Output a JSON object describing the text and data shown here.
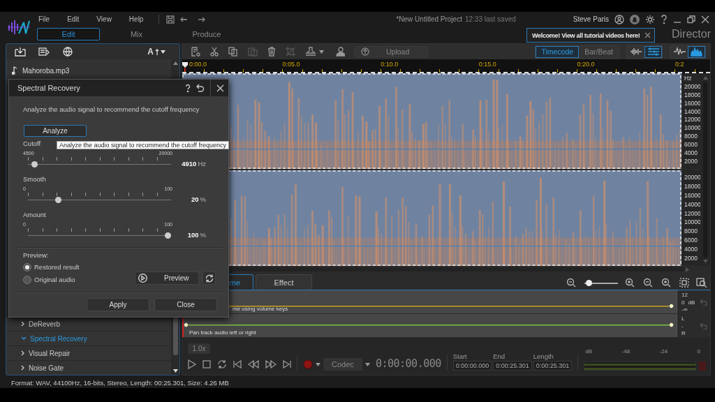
{
  "menu": [
    "File",
    "Edit",
    "View",
    "Help"
  ],
  "project": {
    "title": "*New Untitled Project",
    "saved": "12:33 last saved"
  },
  "user": {
    "name": "Steve Paris"
  },
  "mode_tabs": [
    {
      "label": "Edit",
      "selected": true
    },
    {
      "label": "Mix",
      "selected": false
    },
    {
      "label": "Produce",
      "selected": false
    }
  ],
  "brand": "Director",
  "welcome_tip": "Welcome! View all tutorial videos here!",
  "library": {
    "font_button": "A",
    "file": "Mahoroba.mp3",
    "effects": [
      {
        "label": "DeReverb",
        "expanded": false
      },
      {
        "label": "Spectral Recovery",
        "expanded": true
      },
      {
        "label": "Visual Repair",
        "expanded": false
      },
      {
        "label": "Noise Gate",
        "expanded": false
      }
    ]
  },
  "toolbar": {
    "upload": "Upload",
    "time_modes": [
      {
        "label": "Timecode",
        "selected": true
      },
      {
        "label": "Bar/Beat",
        "selected": false
      }
    ],
    "view_toggles": [
      {
        "kind": "waveform",
        "selected": false
      },
      {
        "kind": "tracks",
        "selected": true
      },
      {
        "kind": "pulse",
        "selected": false
      },
      {
        "kind": "spectrum",
        "selected": true
      }
    ]
  },
  "ruler": [
    "0:00.0",
    "0:05.0",
    "0:10.0",
    "0:15.0",
    "0:20.0",
    "0:2"
  ],
  "freq_axis": {
    "unit": "Hz",
    "channels": [
      [
        "20000",
        "18000",
        "16000",
        "14000",
        "12000",
        "10000",
        "8000",
        "6000",
        "4000",
        "2000"
      ],
      [
        "20000",
        "18000",
        "16000",
        "14000",
        "12000",
        "10000",
        "8000",
        "6000",
        "4000",
        "2000"
      ]
    ]
  },
  "lane_tabs": [
    {
      "label": "me",
      "selected": true
    },
    {
      "label": "Effect",
      "selected": false
    }
  ],
  "zoom": {
    "level": 0.05
  },
  "envelopes": [
    {
      "kind": "volume",
      "hint": "me using volume keys",
      "scale": [
        "12",
        "0",
        "-∞"
      ],
      "unit": "dB"
    },
    {
      "kind": "pan",
      "hint": "Pan track audio left or right",
      "scale": [
        "L",
        "-",
        "R"
      ]
    }
  ],
  "transport": {
    "speed": "1.0x",
    "codec": "Codec",
    "time": "0:00:00.000",
    "fields": [
      {
        "label": "Start",
        "value": "0:00:00.000"
      },
      {
        "label": "End",
        "value": "0:00:25.301"
      },
      {
        "label": "Length",
        "value": "0:00:25.301"
      }
    ],
    "meter_scale": [
      "dB",
      "-48",
      "-24",
      "0"
    ]
  },
  "dialog": {
    "title": "Spectral Recovery",
    "description": "Analyze the audio signal to recommend the cutoff frequency",
    "analyze": "Analyze",
    "tooltip": "Analyze the audio signal to recommend the cutoff frequency",
    "sliders": [
      {
        "label": "Cutoff",
        "min": "4500",
        "max": "20000",
        "level": 0.026,
        "value": "4910",
        "unit": "Hz"
      },
      {
        "label": "Smooth",
        "min": "0",
        "max": "100",
        "level": 0.2,
        "value": "20",
        "unit": "%"
      },
      {
        "label": "Amount",
        "min": "0",
        "max": "100",
        "level": 1,
        "value": "100",
        "unit": "%"
      }
    ],
    "preview_label": "Preview:",
    "preview_options": [
      {
        "label": "Restored result",
        "selected": true
      },
      {
        "label": "Original audio",
        "selected": false
      }
    ],
    "preview_button": "Preview",
    "buttons": [
      "Apply",
      "Close"
    ]
  },
  "status_bar": "Format: WAV, 44100Hz, 16-bits, Stereo, Length: 00:25.301, Size: 4.26 MB"
}
